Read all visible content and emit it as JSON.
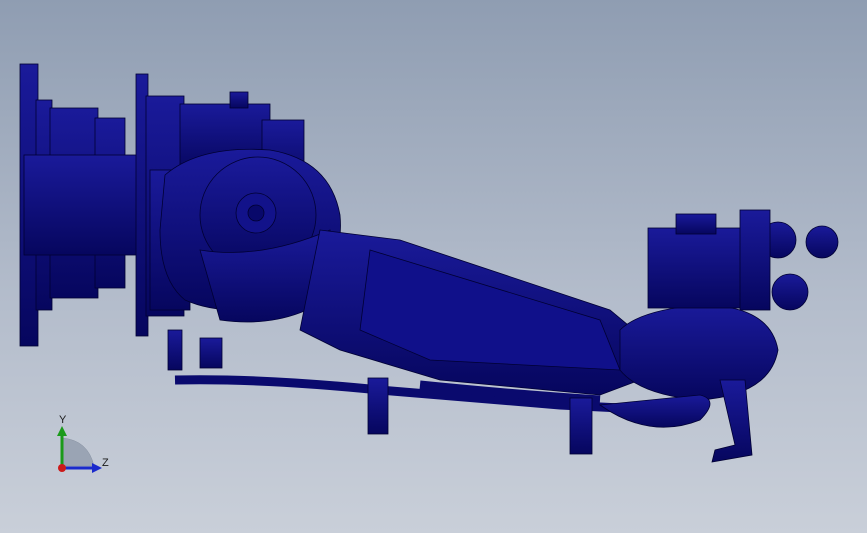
{
  "viewport": {
    "view": "right",
    "render_style": "shaded with edges",
    "part_color": "#0a0a7a",
    "edge_color": "#000030",
    "background_top": "#8f9db2",
    "background_bottom": "#c9cfd9"
  },
  "triad": {
    "y_label": "Y",
    "z_label": "Z",
    "y_color": "#1a9a1a",
    "z_color": "#1a2acc",
    "x_color": "#cc1a1a"
  }
}
